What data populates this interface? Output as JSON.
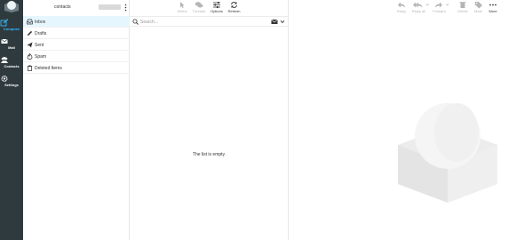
{
  "taskmenu": {
    "items": [
      {
        "label": "Compose",
        "icon": "compose-icon",
        "active": true
      },
      {
        "label": "Mail",
        "icon": "mail-icon",
        "active": false
      },
      {
        "label": "Contacts",
        "icon": "contacts-icon",
        "active": false
      },
      {
        "label": "Settings",
        "icon": "settings-icon",
        "active": false
      }
    ]
  },
  "folders": {
    "account": "contacts",
    "items": [
      {
        "name": "Inbox",
        "icon": "inbox-icon",
        "selected": true
      },
      {
        "name": "Drafts",
        "icon": "pencil-icon",
        "selected": false
      },
      {
        "name": "Sent",
        "icon": "paper-plane-icon",
        "selected": false
      },
      {
        "name": "Spam",
        "icon": "fire-icon",
        "selected": false
      },
      {
        "name": "Deleted Items",
        "icon": "trash-icon",
        "selected": false
      }
    ]
  },
  "msglist": {
    "toolbar": [
      {
        "label": "Select",
        "icon": "cursor-icon",
        "enabled": false
      },
      {
        "label": "Threads",
        "icon": "threads-icon",
        "enabled": false
      },
      {
        "label": "Options",
        "icon": "sliders-icon",
        "enabled": true
      },
      {
        "label": "Refresh",
        "icon": "refresh-icon",
        "enabled": true
      }
    ],
    "search_placeholder": "Search...",
    "empty_message": "The list is empty."
  },
  "content": {
    "toolbar": [
      {
        "label": "Reply",
        "icon": "reply-icon",
        "enabled": false
      },
      {
        "label": "Reply all",
        "icon": "reply-all-icon",
        "enabled": false
      },
      {
        "label": "Forward",
        "icon": "forward-icon",
        "enabled": false
      },
      {
        "label": "Delete",
        "icon": "trash-icon",
        "enabled": false
      },
      {
        "label": "Mark",
        "icon": "tag-icon",
        "enabled": false
      },
      {
        "label": "More",
        "icon": "more-icon",
        "enabled": true
      }
    ]
  },
  "colors": {
    "taskmenu_bg": "#2f3a3f",
    "accent": "#37beff",
    "selected_row": "#e6f6ff",
    "disabled_text": "#b5b5b5"
  }
}
